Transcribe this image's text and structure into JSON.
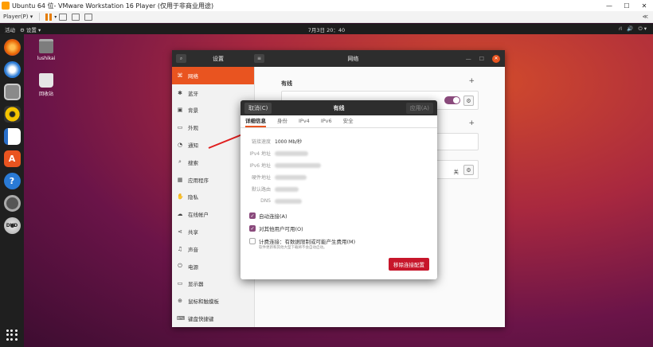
{
  "vm": {
    "title": "Ubuntu 64 位- VMware Workstation 16 Player (仅用于非商业用途)",
    "player_menu": "Player(P) ▾",
    "minimize": "—",
    "maximize": "☐",
    "close": "✕",
    "right_hint": "≪"
  },
  "topbar": {
    "activities": "活动",
    "app_menu": "⚙ 设置 ▾",
    "clock": "7月3日 20：40",
    "tray_network": "⛙",
    "tray_sound": "🔊",
    "tray_power": "⏻ ▾"
  },
  "desktop": {
    "home_label": "lushikai",
    "trash_label": "回收站"
  },
  "settings": {
    "title": "设置",
    "main_title": "网络",
    "sidebar": [
      {
        "icon": "⌘",
        "label": "网络"
      },
      {
        "icon": "✱",
        "label": "蓝牙"
      },
      {
        "icon": "▣",
        "label": "背景"
      },
      {
        "icon": "▭",
        "label": "外观"
      },
      {
        "icon": "◔",
        "label": "通知"
      },
      {
        "icon": "⌕",
        "label": "搜索"
      },
      {
        "icon": "▦",
        "label": "应用程序"
      },
      {
        "icon": "✋",
        "label": "隐私"
      },
      {
        "icon": "☁",
        "label": "在线帐户"
      },
      {
        "icon": "⋖",
        "label": "共享"
      },
      {
        "icon": "♫",
        "label": "声音"
      },
      {
        "icon": "⏻",
        "label": "电源"
      },
      {
        "icon": "▭",
        "label": "显示器"
      },
      {
        "icon": "⊕",
        "label": "鼠标和触摸板"
      },
      {
        "icon": "⌨",
        "label": "键盘快捷键"
      }
    ],
    "wired_header": "有线",
    "vpn_off": "关",
    "plus": "+"
  },
  "dialog": {
    "cancel": "取消(C)",
    "title": "有线",
    "apply": "应用(A)",
    "tabs": [
      "详细信息",
      "身份",
      "IPv4",
      "IPv6",
      "安全"
    ],
    "rows": [
      {
        "label": "链接速度",
        "value": "1000 Mb/秒"
      },
      {
        "label": "IPv4 地址",
        "value": ""
      },
      {
        "label": "IPv6 地址",
        "value": ""
      },
      {
        "label": "硬件地址",
        "value": ""
      },
      {
        "label": "默认路由",
        "value": ""
      },
      {
        "label": "DNS",
        "value": ""
      }
    ],
    "auto_connect": "自动连接(A)",
    "available_all": "对其他用户可用(O)",
    "metered": "计费连接：有数据限制或可能产生费用(M)",
    "metered_note": "软件更新和其他大型下载将不会自动启动。",
    "remove": "移除连接配置"
  }
}
